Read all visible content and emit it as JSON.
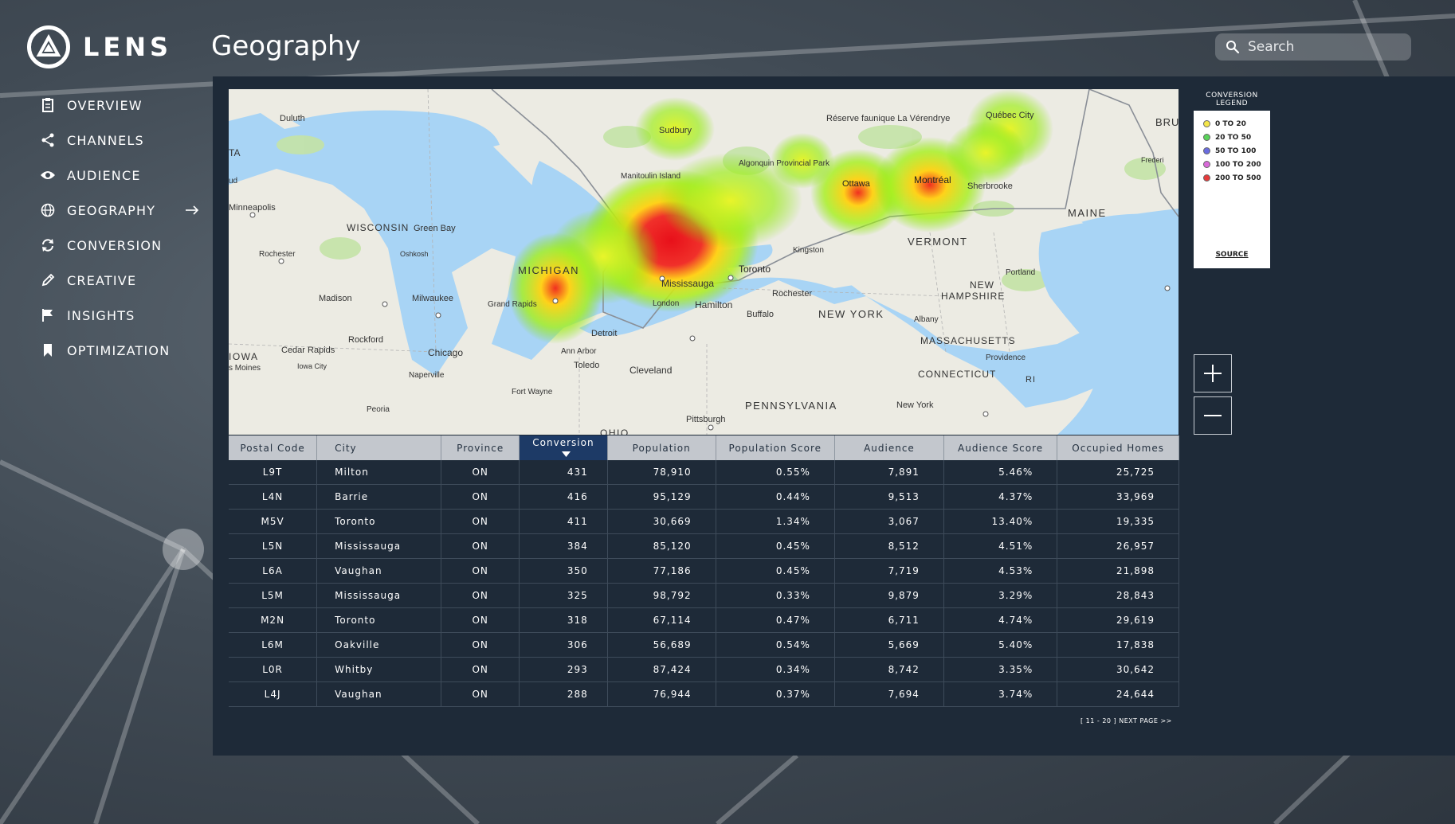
{
  "app": {
    "name": "LENS"
  },
  "page": {
    "title": "Geography"
  },
  "search": {
    "placeholder": "Search",
    "icon": "search-icon"
  },
  "nav": {
    "items": [
      {
        "label": "OVERVIEW",
        "icon": "clipboard-icon"
      },
      {
        "label": "CHANNELS",
        "icon": "share-icon"
      },
      {
        "label": "AUDIENCE",
        "icon": "eye-icon"
      },
      {
        "label": "GEOGRAPHY",
        "icon": "globe-icon",
        "active": true
      },
      {
        "label": "CONVERSION",
        "icon": "refresh-icon"
      },
      {
        "label": "CREATIVE",
        "icon": "pencil-icon"
      },
      {
        "label": "INSIGHTS",
        "icon": "flag-icon"
      },
      {
        "label": "OPTIMIZATION",
        "icon": "bookmark-icon"
      }
    ]
  },
  "map": {
    "labels": {
      "duluth": "Duluth",
      "sudbury": "Sudbury",
      "reserve": "Réserve faunique La Vérendrye",
      "quebec": "Québec City",
      "bru": "BRU",
      "fredericton": "Frederi",
      "ta": "TA",
      "ud": "ud",
      "manitoulin": "Manitoulin Island",
      "algonquin": "Algonquin Provincial Park",
      "ottawa": "Ottawa",
      "montreal": "Montréal",
      "sherbrooke": "Sherbrooke",
      "maine": "MAINE",
      "minneapolis": "Minneapolis",
      "wisconsin": "WISCONSIN",
      "green_bay": "Green Bay",
      "rochester_mn": "Rochester",
      "oshkosh": "Oshkosh",
      "michigan": "MICHIGAN",
      "toronto": "Toronto",
      "mississauga": "Mississauga",
      "kingston": "Kingston",
      "vermont": "VERMONT",
      "portland": "Portland",
      "new_hampshire": "NEW HAMPSHIRE",
      "madison": "Madison",
      "milwaukee": "Milwaukee",
      "grand_rapids": "Grand Rapids",
      "london": "London",
      "hamilton": "Hamilton",
      "rochester_ny": "Rochester",
      "buffalo": "Buffalo",
      "new_york_state": "NEW YORK",
      "albany": "Albany",
      "massachusetts": "MASSACHUSETTS",
      "providence": "Providence",
      "rockford": "Rockford",
      "detroit": "Detroit",
      "iowa": "IOWA",
      "cedar_rapids": "Cedar Rapids",
      "chicago": "Chicago",
      "ann_arbor": "Ann Arbor",
      "des_moines": "s Moines",
      "iowa_city": "Iowa City",
      "naperville": "Naperville",
      "toledo": "Toledo",
      "cleveland": "Cleveland",
      "connecticut": "CONNECTICUT",
      "ri": "RI",
      "fort_wayne": "Fort Wayne",
      "peoria": "Peoria",
      "new_york_city": "New York",
      "pennsylvania": "PENNSYLVANIA",
      "pittsburgh": "Pittsburgh",
      "ohio": "OHIO"
    }
  },
  "legend": {
    "title": "CONVERSION LEGEND",
    "items": [
      {
        "label": "0 TO 20",
        "color": "#f4e64a"
      },
      {
        "label": "20 TO 50",
        "color": "#5ad35a"
      },
      {
        "label": "50 TO 100",
        "color": "#6a6ce0"
      },
      {
        "label": "100 TO 200",
        "color": "#d96ad9"
      },
      {
        "label": "200 TO 500",
        "color": "#e63b3b"
      }
    ],
    "source": "SOURCE"
  },
  "zoom": {
    "in_icon": "plus-icon",
    "out_icon": "minus-icon"
  },
  "table": {
    "headers": [
      "Postal Code",
      "City",
      "Province",
      "Conversion",
      "Population",
      "Population Score",
      "Audience",
      "Audience Score",
      "Occupied Homes"
    ],
    "sort_icon": "caret-down-icon",
    "rows": [
      [
        "L9T",
        "Milton",
        "ON",
        "431",
        "78,910",
        "0.55%",
        "7,891",
        "5.46%",
        "25,725"
      ],
      [
        "L4N",
        "Barrie",
        "ON",
        "416",
        "95,129",
        "0.44%",
        "9,513",
        "4.37%",
        "33,969"
      ],
      [
        "M5V",
        "Toronto",
        "ON",
        "411",
        "30,669",
        "1.34%",
        "3,067",
        "13.40%",
        "19,335"
      ],
      [
        "L5N",
        "Mississauga",
        "ON",
        "384",
        "85,120",
        "0.45%",
        "8,512",
        "4.51%",
        "26,957"
      ],
      [
        "L6A",
        "Vaughan",
        "ON",
        "350",
        "77,186",
        "0.45%",
        "7,719",
        "4.53%",
        "21,898"
      ],
      [
        "L5M",
        "Mississauga",
        "ON",
        "325",
        "98,792",
        "0.33%",
        "9,879",
        "3.29%",
        "28,843"
      ],
      [
        "M2N",
        "Toronto",
        "ON",
        "318",
        "67,114",
        "0.47%",
        "6,711",
        "4.74%",
        "29,619"
      ],
      [
        "L6M",
        "Oakville",
        "ON",
        "306",
        "56,689",
        "0.54%",
        "5,669",
        "5.40%",
        "17,838"
      ],
      [
        "L0R",
        "Whitby",
        "ON",
        "293",
        "87,424",
        "0.34%",
        "8,742",
        "3.35%",
        "30,642"
      ],
      [
        "L4J",
        "Vaughan",
        "ON",
        "288",
        "76,944",
        "0.37%",
        "7,694",
        "3.74%",
        "24,644"
      ]
    ]
  },
  "pager": {
    "label": "[ 11 - 20 ] NEXT PAGE >>"
  }
}
